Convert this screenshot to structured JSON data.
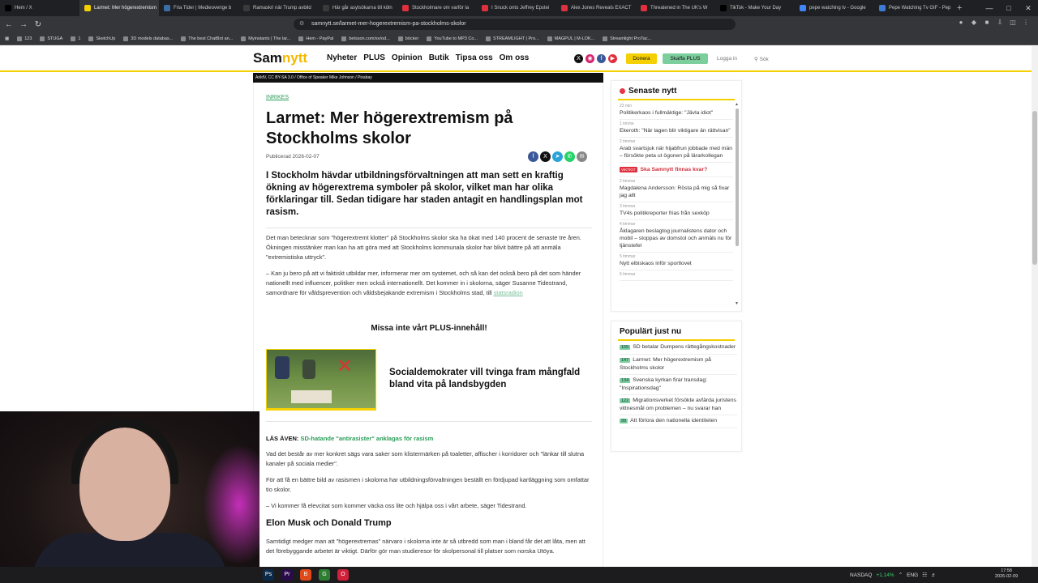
{
  "browser": {
    "tabs": [
      {
        "label": "Hem / X",
        "color": "#000000"
      },
      {
        "label": "Larmet: Mer högerextremism",
        "color": "#f5d000",
        "active": true
      },
      {
        "label": "Fria Tider | Medieoverige b",
        "color": "#3b6ea5"
      },
      {
        "label": "Ramaskri när Trump avbild",
        "color": "#3a3a3a"
      },
      {
        "label": "Här går asylsökarna till köln",
        "color": "#3a3a3a"
      },
      {
        "label": "Stockholmare om varför la",
        "color": "#e0303d"
      },
      {
        "label": "I Snuck onto Jeffrey Epstei",
        "color": "#e0303d"
      },
      {
        "label": "Alex Jones Reveals EXACT",
        "color": "#e0303d"
      },
      {
        "label": "Threatened in The UK's W",
        "color": "#e0303d"
      },
      {
        "label": "TikTok - Make Your Day",
        "color": "#000000"
      },
      {
        "label": "pepe watching tv - Google",
        "color": "#4285f4"
      },
      {
        "label": "Pepe Watching Tv GIF - Pep",
        "color": "#3d7bd6"
      }
    ],
    "new_tab": "+",
    "url": "samnytt.se/larmet-mer-hogerextremism-pa-stockholms-skolor",
    "bookmarks": [
      "123",
      "STUGA",
      "1",
      "SketchUp",
      "3D models databas...",
      "The best ChatBot an...",
      "Myinstants | The lar...",
      "Hem - PayPal",
      "betsson.com/sv/od...",
      "böcker",
      "YouTube to MP3 Co...",
      "STREAMLIGHT | Pro...",
      "MAGPUL | M-LOK...",
      "Streamlight ProTac..."
    ]
  },
  "site": {
    "logo_a": "Sam",
    "logo_b": "nytt",
    "menu": [
      "Nyheter",
      "PLUS",
      "Opinion",
      "Butik",
      "Tipsa oss",
      "Om oss"
    ],
    "donera": "Donera",
    "skaffa_plus": "Skaffa PLUS",
    "logga_in": "Logga in",
    "sok": "Sök"
  },
  "article": {
    "image_credit": "ArildV, CC BY-SA 3.0 / Office of Speaker Mike Johnson / Pixabay",
    "category": "INRIKES",
    "title": "Larmet: Mer högerextremism på Stockholms skolor",
    "published": "Publicerad 2026-02-07",
    "lead": "I Stockholm hävdar utbildningsförvaltningen att man sett en kraftig ökning av högerextrema symboler på skolor, vilket man har olika förklaringar till. Sedan tidigare har staden antagit en handlingsplan mot rasism.",
    "p1": "Det man betecknar som \"högerextremt klotter\" på Stockholms skolor ska ha ökat med 140 procent de senaste tre åren. Ökningen misstänker man kan ha att göra med att Stockholms kommunala skolor har blivit bättre på att anmäla \"extremistiska uttryck\".",
    "p2": "– Kan ju bero på att vi faktiskt utbildar mer, informerar mer om systemet, och så kan det också bero på det som händer nationellt med influencer, politiker men också internationellt. Det kommer in i skolorna, säger Susanne Tidestrand, samordnare för våldsprevention och våldsbejakande extremism i Stockholms stad, till",
    "p2_link": "statsradion",
    "missa": "Missa inte vårt PLUS-innehåll!",
    "promo_title": "Socialdemokrater vill tvinga fram mångfald bland vita på landsbygden",
    "las_aven_label": "LÄS ÄVEN:",
    "las_aven_link": "SD-hatande \"antirasister\" anklagas för rasism",
    "p3": "Vad det består av mer konkret sägs vara saker som klistermärken på toaletter, affischer i korridorer och \"länkar till slutna kanaler på sociala medier\".",
    "p4": "För att få en bättre bild av rasismen i skolorna har utbildningsförvaltningen beställt en fördjupad kartläggning som omfattar tio skolor.",
    "p5": "– Vi kommer få elevcitat som kommer väcka oss lite och hjälpa oss i vårt arbete, säger Tidestrand.",
    "h2": "Elon Musk och Donald Trump",
    "p6": "Samtidigt medger man att \"högerextremas\" närvaro i skolorna inte är så utbredd som man i bland får det att låta, men att det förebyggande arbetet är viktigt. Därför gör man studieresor för skolpersonal till platser som norska Utöya."
  },
  "sidebar": {
    "latest_title": "Senaste nytt",
    "latest": [
      {
        "time": "23 min",
        "headline": "Politikerkaos i fullmäktige: \"Jävla idiot\""
      },
      {
        "time": "1 timme",
        "headline": "Ekeroth: \"När lagen blir viktigare än rättvisan\""
      },
      {
        "time": "2 timmar",
        "headline": "Arab svartsjuk när hijabfrun jobbade med män – försökte peta ut ögonen på lärarkollegan"
      },
      {
        "badge": "VIKTIGT",
        "headline": "Ska Samnytt finnas kvar?",
        "important": true
      },
      {
        "time": "2 timmar",
        "headline": "Magdalena Andersson: Rösta på mig så fixar jag allt"
      },
      {
        "time": "3 timmar",
        "headline": "TV4s politikreporter frias från sexköp"
      },
      {
        "time": "4 timmar",
        "headline": "Åklagaren beslagtog journalistens dator och mobil – stoppas av domstol och anmäls nu för tjänstefel"
      },
      {
        "time": "5 timmar",
        "headline": "Nytt elbiskaos inför sportlovet"
      },
      {
        "time": "6 timmar",
        "headline": ""
      }
    ],
    "popular_title": "Populärt just nu",
    "popular": [
      {
        "count": "155",
        "headline": "SD betalar Dumpens rättegångskostnader"
      },
      {
        "count": "147",
        "headline": "Larmet: Mer högerextremism på Stockholms skolor"
      },
      {
        "count": "134",
        "headline": "Svenska kyrkan firar transdag: \"Inspirationsdag\""
      },
      {
        "count": "122",
        "headline": "Migrationsverket försökte avfärda juristens vittnesmål om problemen – nu svarar han"
      },
      {
        "count": "99",
        "headline": "Att förlora den nationella identiteten"
      }
    ]
  },
  "taskbar": {
    "apps": [
      {
        "label": "Ps",
        "color": "#0b2a4a"
      },
      {
        "label": "Pr",
        "color": "#2a0b4a"
      },
      {
        "label": "B",
        "color": "#e04a1a"
      },
      {
        "label": "G",
        "color": "#2e7d32"
      },
      {
        "label": "O",
        "color": "#d0203a"
      }
    ],
    "stock_label": "NASDAQ",
    "stock_change": "+1,14%",
    "lang": "ENG",
    "time": "17:58",
    "date": "2026-02-09"
  }
}
